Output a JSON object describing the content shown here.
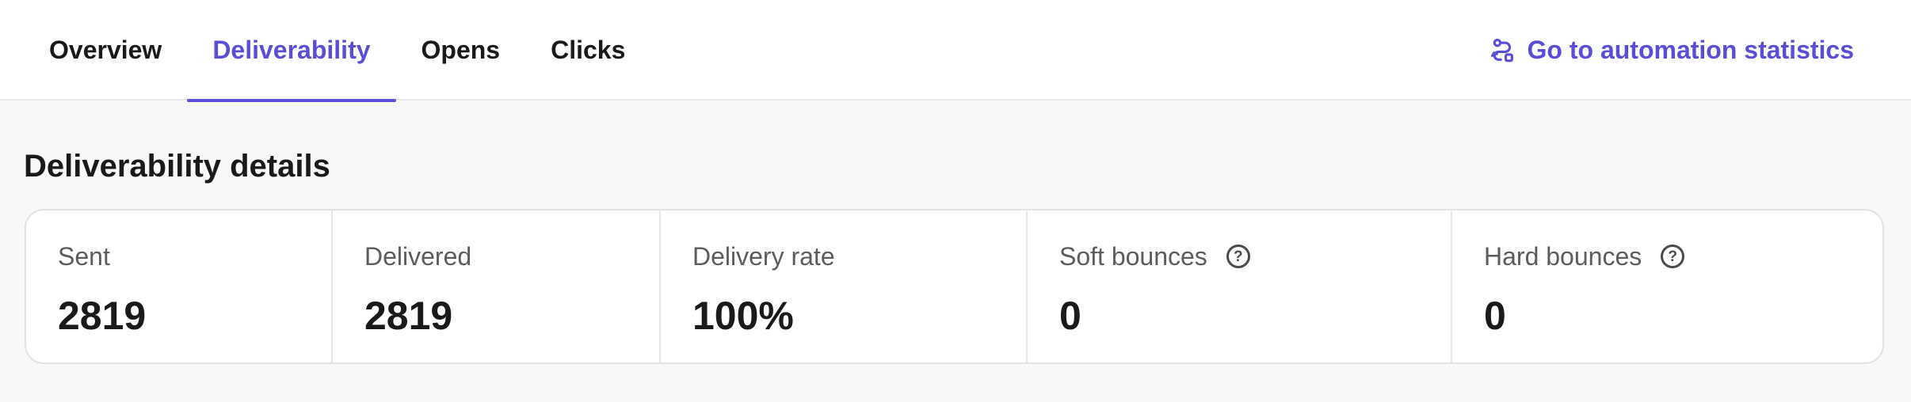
{
  "tabs": [
    {
      "label": "Overview",
      "active": false
    },
    {
      "label": "Deliverability",
      "active": true
    },
    {
      "label": "Opens",
      "active": false
    },
    {
      "label": "Clicks",
      "active": false
    }
  ],
  "automation_link": {
    "label": "Go to automation statistics",
    "icon": "automation-icon"
  },
  "section_title": "Deliverability details",
  "stats": [
    {
      "label": "Sent",
      "value": "2819",
      "help": false
    },
    {
      "label": "Delivered",
      "value": "2819",
      "help": false
    },
    {
      "label": "Delivery rate",
      "value": "100%",
      "help": false
    },
    {
      "label": "Soft bounces",
      "value": "0",
      "help": true
    },
    {
      "label": "Hard bounces",
      "value": "0",
      "help": true
    }
  ],
  "help_icon_glyph": "?",
  "colors": {
    "accent": "#5b4ed6",
    "text": "#1a1a1a",
    "muted": "#5c5c5c",
    "background": "#f8f8f8"
  }
}
